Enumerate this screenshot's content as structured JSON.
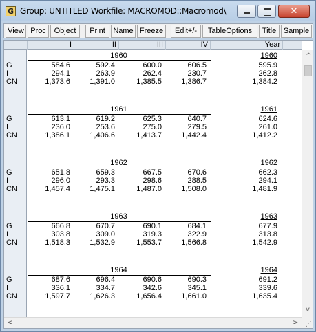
{
  "window": {
    "title": "Group: UNTITLED   Workfile: MACROMOD::Macromod\\",
    "icon_letter": "G",
    "close_glyph": "✕"
  },
  "toolbar": {
    "buttons": [
      "View",
      "Proc",
      "Object",
      "Print",
      "Name",
      "Freeze",
      "Edit+/-",
      "TableOptions",
      "Title",
      "Sample"
    ]
  },
  "columns": {
    "q1": "I",
    "q2": "II",
    "q3": "III",
    "q4": "IV",
    "year": "Year"
  },
  "series_labels": {
    "g": "G",
    "i": "I",
    "cn": "CN"
  },
  "years": [
    {
      "year": "1960",
      "g": [
        "584.6",
        "592.4",
        "600.0",
        "606.5",
        "595.9"
      ],
      "i": [
        "294.1",
        "263.9",
        "262.4",
        "230.7",
        "262.8"
      ],
      "cn": [
        "1,373.6",
        "1,391.0",
        "1,385.5",
        "1,386.7",
        "1,384.2"
      ]
    },
    {
      "year": "1961",
      "g": [
        "613.1",
        "619.2",
        "625.3",
        "640.7",
        "624.6"
      ],
      "i": [
        "236.0",
        "253.6",
        "275.0",
        "279.5",
        "261.0"
      ],
      "cn": [
        "1,386.1",
        "1,406.6",
        "1,413.7",
        "1,442.4",
        "1,412.2"
      ]
    },
    {
      "year": "1962",
      "g": [
        "651.8",
        "659.3",
        "667.5",
        "670.6",
        "662.3"
      ],
      "i": [
        "296.0",
        "293.3",
        "298.6",
        "288.5",
        "294.1"
      ],
      "cn": [
        "1,457.4",
        "1,475.1",
        "1,487.0",
        "1,508.0",
        "1,481.9"
      ]
    },
    {
      "year": "1963",
      "g": [
        "666.8",
        "670.7",
        "690.1",
        "684.1",
        "677.9"
      ],
      "i": [
        "303.8",
        "309.0",
        "319.3",
        "322.9",
        "313.8"
      ],
      "cn": [
        "1,518.3",
        "1,532.9",
        "1,553.7",
        "1,566.8",
        "1,542.9"
      ]
    },
    {
      "year": "1964",
      "g": [
        "687.6",
        "696.4",
        "690.6",
        "690.3",
        "691.2"
      ],
      "i": [
        "336.1",
        "334.7",
        "342.6",
        "345.1",
        "339.6"
      ],
      "cn": [
        "1,597.7",
        "1,626.3",
        "1,656.4",
        "1,661.0",
        "1,635.4"
      ]
    }
  ],
  "scroll": {
    "up": "^",
    "down": "v",
    "left": "<",
    "right": ">"
  }
}
